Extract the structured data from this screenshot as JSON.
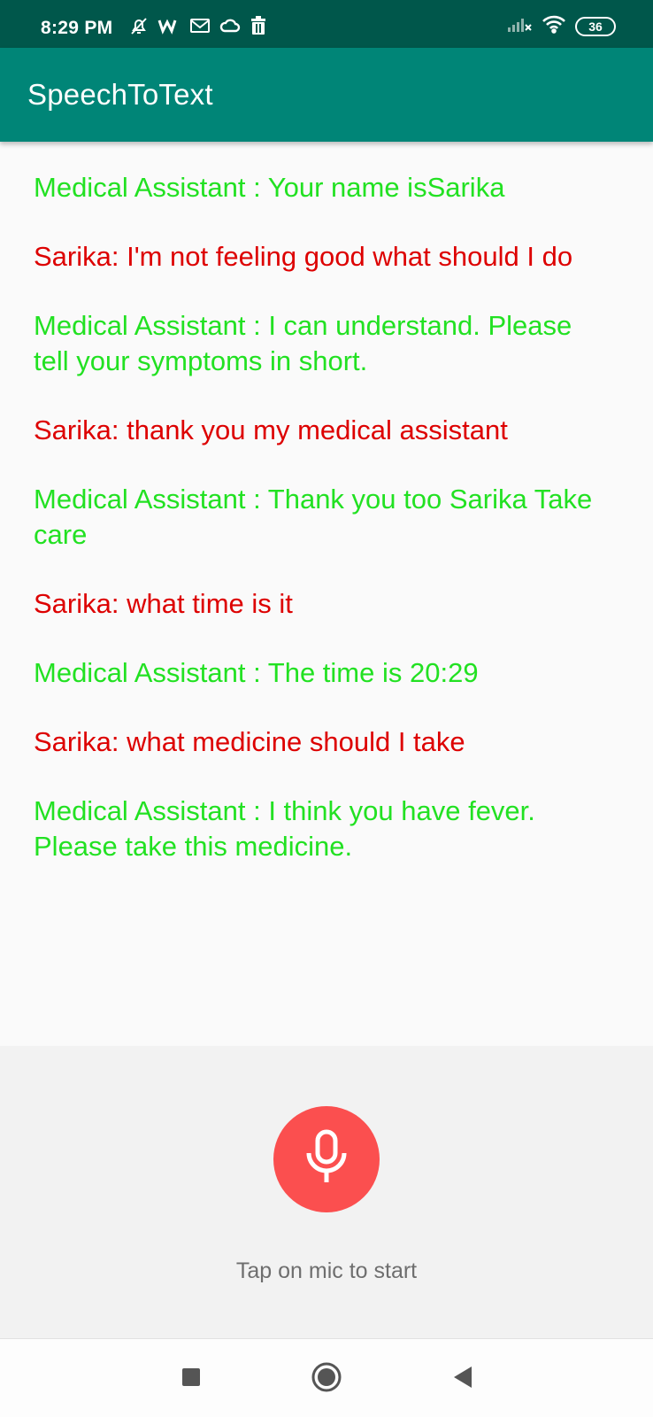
{
  "status_bar": {
    "time": "8:29 PM",
    "battery": "36",
    "icons": [
      "mute-icon",
      "w-icon",
      "gmail-icon",
      "cloud-icon",
      "trash-icon",
      "signal-icon",
      "wifi-icon",
      "battery-icon"
    ]
  },
  "app_bar": {
    "title": "SpeechToText"
  },
  "chat": {
    "messages": [
      {
        "speaker": "assistant",
        "text": "Medical Assistant : Your name isSarika"
      },
      {
        "speaker": "user",
        "text": "Sarika: I'm not feeling good what should I do"
      },
      {
        "speaker": "assistant",
        "text": "Medical Assistant : I can understand. Please tell your symptoms in short."
      },
      {
        "speaker": "user",
        "text": "Sarika: thank you my medical assistant"
      },
      {
        "speaker": "assistant",
        "text": "Medical Assistant : Thank you too Sarika Take care"
      },
      {
        "speaker": "user",
        "text": "Sarika: what time is it"
      },
      {
        "speaker": "assistant",
        "text": "Medical Assistant : The time is 20:29"
      },
      {
        "speaker": "user",
        "text": "Sarika: what medicine should I take"
      },
      {
        "speaker": "assistant",
        "text": "Medical Assistant : I think you have fever. Please take this medicine."
      }
    ]
  },
  "mic": {
    "hint": "Tap on mic to start",
    "icon": "microphone-icon"
  },
  "colors": {
    "status_bar": "#00574b",
    "app_bar": "#008577",
    "assistant_text": "#22e122",
    "user_text": "#dd0000",
    "mic_button": "#fb4f4f"
  },
  "nav_bar": {
    "icons": [
      "recents-square-icon",
      "home-circle-icon",
      "back-triangle-icon"
    ]
  }
}
